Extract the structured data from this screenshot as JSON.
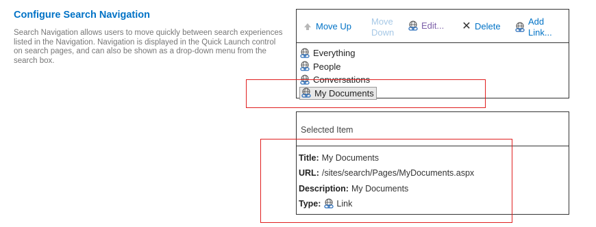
{
  "section": {
    "title": "Configure Search Navigation",
    "description": "Search Navigation allows users to move quickly between search experiences listed in the Navigation. Navigation is displayed in the Quick Launch control on search pages, and can also be shown as a drop-down menu from the search box."
  },
  "toolbar": {
    "move_up": "Move Up",
    "move_down": "Move Down",
    "edit": "Edit...",
    "delete": "Delete",
    "add_link": "Add Link..."
  },
  "nav_items": [
    {
      "label": "Everything",
      "icon": "link-globe-icon"
    },
    {
      "label": "People",
      "icon": "link-globe-icon"
    },
    {
      "label": "Conversations",
      "icon": "link-globe-icon"
    },
    {
      "label": "My Documents",
      "icon": "link-globe-icon",
      "selected": true
    }
  ],
  "selected_item": {
    "header": "Selected Item",
    "title_label": "Title:",
    "title_value": "My Documents",
    "url_label": "URL:",
    "url_value": "/sites/search/Pages/MyDocuments.aspx",
    "description_label": "Description:",
    "description_value": "My Documents",
    "type_label": "Type:",
    "type_value": "Link"
  },
  "colors": {
    "accent": "#0072c6",
    "annotation": "#e01e1e"
  }
}
